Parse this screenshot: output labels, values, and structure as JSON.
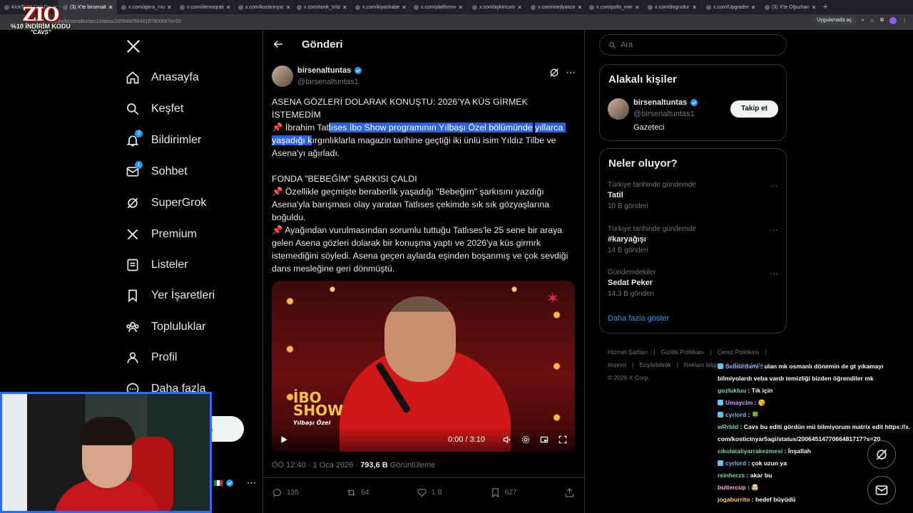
{
  "browser": {
    "tabs": [
      {
        "label": "KickSight Link De"
      },
      {
        "label": "(3) X'te birsenalt",
        "active": true
      },
      {
        "label": "x.com/ajans_mu"
      },
      {
        "label": "x.com/demoqrati"
      },
      {
        "label": "x.com/kosticinyar"
      },
      {
        "label": "x.com/tanik_tr/st"
      },
      {
        "label": "x.com/kiyashabe"
      },
      {
        "label": "x.com/platformv"
      },
      {
        "label": "x.com/aykiricom"
      },
      {
        "label": "x.com/medyasco"
      },
      {
        "label": "x.com/polis_mer"
      },
      {
        "label": "x.com/dogrudur"
      },
      {
        "label": "x.com/Upgrader"
      },
      {
        "label": "(3) X'te Oğuzhan"
      }
    ],
    "url": "x.com/birsenaltuntas1/status/2006480664019780068?s=20",
    "open_in_app": "Uygulamada aç"
  },
  "overlay": {
    "logo": "ZIO",
    "promo": "%10 İNDİRİM KODU",
    "code": "\"CAVS\""
  },
  "nav": {
    "items": [
      {
        "label": "Anasayfa",
        "icon": "home-icon"
      },
      {
        "label": "Keşfet",
        "icon": "search-icon"
      },
      {
        "label": "Bildirimler",
        "icon": "bell-icon",
        "badge": "2"
      },
      {
        "label": "Sohbet",
        "icon": "mail-icon",
        "badge": "1"
      },
      {
        "label": "SuperGrok",
        "icon": "grok-icon"
      },
      {
        "label": "Premium",
        "icon": "x-icon"
      },
      {
        "label": "Listeler",
        "icon": "list-icon"
      },
      {
        "label": "Yer İşaretleri",
        "icon": "bookmark-icon"
      },
      {
        "label": "Topluluklar",
        "icon": "communities-icon"
      },
      {
        "label": "Profil",
        "icon": "profile-icon"
      },
      {
        "label": "Daha fazla",
        "icon": "more-icon"
      }
    ],
    "post_button_partial": "a"
  },
  "post": {
    "header_title": "Gönderi",
    "author_name": "birsenaltuntas",
    "author_handle": "@birsenaltuntas1",
    "headline": "ASENA GÖZLERİ DOLARAK KONUŞTU: 2026'YA KÜS GİRMEK İSTEMEDİM",
    "p1_pre": " İbrahim Tat",
    "p1_highlight_a": "lıses İbo Show programının Yılbaşı Özel bölümünde",
    "p1_highlight_b": "yıllarca yaşadığı k",
    "p1_post": "ırgınlıklarla magazin tarihine geçtiği iki ünlü isim Yıldız Tilbe ve Asena'yı ağırladı.",
    "subhead": "FONDA \"BEBEĞİM\" ŞARKISI ÇALDI",
    "p2": " Özellikle geçmişte beraberlik yaşadığı \"Bebeğim\" şarkısını yazdığı Asena'yla barışması olay yaratan Tatlıses çekimde sık sık gözyaşlarına boğuldu.",
    "p3": " Ayağından vurulmasından sorumlu tuttuğu Tatlıses'le 25 sene bir araya gelen Asena gözleri dolarak bir konuşma yaptı ve 2026'ya küs girmrk istemediğini söyledi. Asena geçen aylarda eşinden boşanmış ve çok sevdiği dans mesleğine geri dönmüştü.",
    "pin_emoji": "📌",
    "video": {
      "time": "0:00 / 3:10",
      "show_label_1": "İBO",
      "show_label_2": "SHOW",
      "show_label_3": "Yılbaşı Özel"
    },
    "meta_time": "ÖÖ 12:40 · 1 Oca 2026 · ",
    "meta_views": "793,6 B",
    "meta_views_label": " Görüntüleme",
    "replies": "135",
    "reposts": "64",
    "likes": "1 B",
    "bookmarks": "627"
  },
  "sidebar": {
    "search_placeholder": "Ara",
    "related_title": "Alakalı kişiler",
    "related_person": {
      "name": "birsenaltuntas",
      "handle": "@birsenaltuntas1",
      "bio": "Gazeteci",
      "follow_label": "Takip et"
    },
    "trends_title": "Neler oluyor?",
    "trends": [
      {
        "context": "Türkiye tarihinde gündemde",
        "name": "Tatil",
        "count": "10 B gönderi"
      },
      {
        "context": "Türkiye tarihinde gündemde",
        "name": "#karyağışı",
        "count": "14 B gönderi"
      },
      {
        "context": "Gündemdekiler",
        "name": "Sedat Peker",
        "count": "14,3 B gönderi"
      }
    ],
    "show_more": "Daha fazla göster",
    "footer": [
      "Hizmet Şartları",
      "|",
      "Gizlilik Politikası",
      "|",
      "Çerez Politikası",
      "|",
      "Imprint",
      "|",
      "Erişilebilirlik",
      "|",
      "Reklam bilgisi",
      "|",
      "Daha fazla ...",
      "© 2026 X Corp."
    ]
  },
  "chat": [
    {
      "user": "Selbürdami",
      "text": ": ulan mk osmanlı dönemin de gt yıkamayı bilmiyolardı veba vardı temizliği bizden öğrendiler mk",
      "color": "c3"
    },
    {
      "user": "gozlukluu",
      "text": ": Tık için",
      "color": ""
    },
    {
      "user": "Umaycim",
      "text": ": 😘",
      "color": "c2"
    },
    {
      "user": "cyrlord",
      "text": ": 🍀",
      "color": "c3"
    },
    {
      "user": "wRrbld",
      "text": ": Cavs bu editi gördün mü bilmiyorum matrix edit https://x.com/kosticinyar5agi/status/2006451477066481717?s=20",
      "color": ""
    },
    {
      "user": "cikolataliyarrakezmesi",
      "text": ": İnşallah",
      "color": ""
    },
    {
      "user": "cyrlord",
      "text": ": çok uzun ya",
      "color": "c3"
    },
    {
      "user": "reinherzs",
      "text": ": akar bu",
      "color": ""
    },
    {
      "user": "buttercup",
      "text": ": 🤯",
      "color": "c4"
    },
    {
      "user": "jogaburrito",
      "text": ": hedef büyüdü",
      "color": "c5"
    }
  ],
  "colors": {
    "accent": "#1d9bf0",
    "highlight": "#2962d9",
    "background": "#000000"
  }
}
